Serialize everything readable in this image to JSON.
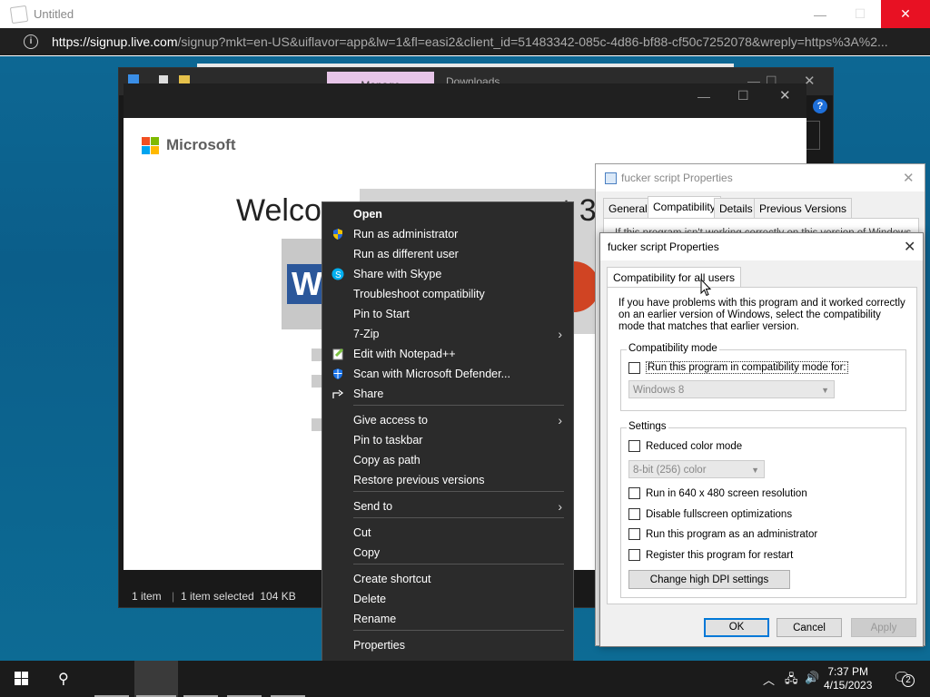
{
  "browser": {
    "window_title": "Untitled",
    "url_host": "https://signup.live.com",
    "url_rest": "/signup?mkt=en-US&uiflavor=app&lw=1&fl=easi2&client_id=51483342-085c-4d86-bf88-cf50c7252078&wreply=https%3A%2...",
    "minimize": "—",
    "maximize": "☐",
    "close": "✕"
  },
  "explorer": {
    "ribbon_tab_manage": "Manage",
    "ribbon_tab_downloads": "Downloads",
    "status_items": "1 item",
    "status_selected": "1 item selected  104 KB"
  },
  "mspage": {
    "brand": "Microsoft",
    "welcome_left": "Welco",
    "welcome_right": "t 3",
    "word_letter": "W"
  },
  "context_menu": {
    "items": [
      {
        "label": "Open",
        "bold": true
      },
      {
        "label": "Run as administrator",
        "icon": "shield-icon"
      },
      {
        "label": "Run as different user"
      },
      {
        "label": "Share with Skype",
        "icon": "skype-icon"
      },
      {
        "label": "Troubleshoot compatibility"
      },
      {
        "label": "Pin to Start"
      },
      {
        "label": "7-Zip",
        "submenu": true
      },
      {
        "label": "Edit with Notepad++",
        "icon": "notepad-icon"
      },
      {
        "label": "Scan with Microsoft Defender...",
        "icon": "defender-icon"
      },
      {
        "label": "Share",
        "icon": "share-icon"
      },
      {
        "label": "Give access to",
        "submenu": true
      },
      {
        "label": "Pin to taskbar"
      },
      {
        "label": "Copy as path"
      },
      {
        "label": "Restore previous versions"
      },
      {
        "label": "Send to",
        "submenu": true
      },
      {
        "label": "Cut"
      },
      {
        "label": "Copy"
      },
      {
        "label": "Create shortcut"
      },
      {
        "label": "Delete"
      },
      {
        "label": "Rename"
      },
      {
        "label": "Properties"
      }
    ]
  },
  "props_back": {
    "title": "fucker script Properties",
    "tabs": [
      "General",
      "Compatibility",
      "Details",
      "Previous Versions"
    ],
    "peek_text": "If this program isn't working correctly on this version of Windows,"
  },
  "props": {
    "title": "fucker script Properties",
    "tab": "Compatibility for all users",
    "description": "If you have problems with this program and it worked correctly on an earlier version of Windows, select the compatibility mode that matches that earlier version.",
    "compat_group": "Compatibility mode",
    "compat_check": "Run this program in compatibility mode for:",
    "compat_select": "Windows 8",
    "settings_group": "Settings",
    "reduced_color": "Reduced color mode",
    "color_select": "8-bit (256) color",
    "res640": "Run in 640 x 480 screen resolution",
    "disable_fullscreen": "Disable fullscreen optimizations",
    "run_admin": "Run this program as an administrator",
    "register_restart": "Register this program for restart",
    "high_dpi_button": "Change high DPI settings",
    "ok": "OK",
    "cancel": "Cancel",
    "apply": "Apply"
  },
  "taskbar": {
    "time": "7:37 PM",
    "date": "4/15/2023",
    "notification_count": "2"
  }
}
